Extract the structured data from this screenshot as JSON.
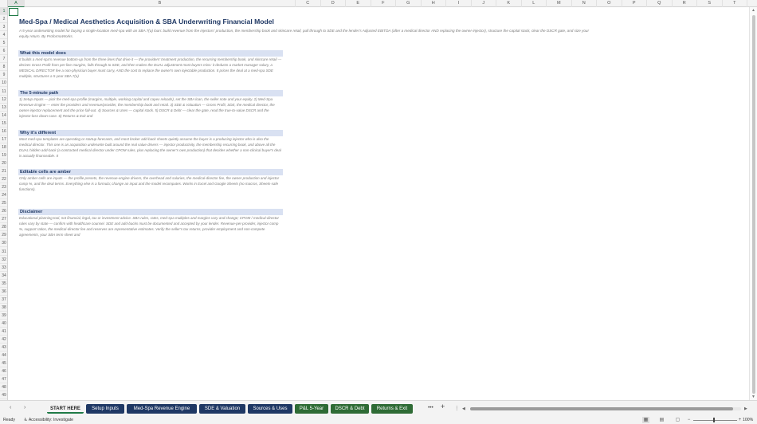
{
  "columns": [
    "A",
    "B",
    "C",
    "D",
    "E",
    "F",
    "G",
    "H",
    "I",
    "J",
    "K",
    "L",
    "M",
    "N",
    "O",
    "P",
    "Q",
    "R",
    "S",
    "T"
  ],
  "active_column": "A",
  "active_row": "1",
  "rows": [
    "1",
    "2",
    "3",
    "4",
    "5",
    "6",
    "7",
    "8",
    "9",
    "10",
    "11",
    "12",
    "13",
    "14",
    "15",
    "16",
    "17",
    "18",
    "19",
    "20",
    "21",
    "22",
    "23",
    "24",
    "25",
    "26",
    "27",
    "28",
    "29",
    "30",
    "31",
    "32",
    "33",
    "34",
    "35",
    "36",
    "37",
    "38",
    "39",
    "40",
    "41",
    "42",
    "43",
    "44",
    "45",
    "46",
    "47",
    "48",
    "49"
  ],
  "sheet": {
    "title": "Med-Spa / Medical Aesthetics Acquisition & SBA Underwriting Financial Model",
    "subtitle": "A 5-year underwriting model for buying a single-location med-spa with an SBA 7(a) loan: build revenue from the injectors' production, the membership book and skincare retail, pull through to SDE and the lender's Adjusted EBITDA (after a medical director AND replacing the owner-injector), structure the capital stack, clear the DSCR gate, and size your equity return. By ProformaWorks.",
    "sections": [
      {
        "heading": "What this model does",
        "body": "It builds a med-spa's revenue bottom-up from the three lines that drive it — the providers' treatment production, the recurring membership book, and skincare retail — derives Gross Profit from per-line margins, falls through to SDE, and then makes the DUAL adjustment most buyers miss: it deducts a market manager salary, a MEDICAL DIRECTOR fee a non-physician buyer must carry, AND the cost to replace the owner's own injectable production. It prices the deal at a med-spa SDE multiple, structures a 5-year SBA 7(a)"
      },
      {
        "heading": "The 5-minute path",
        "body": "1) Setup Inputs — pick the med-spa profile (margins, multiple, working capital and capex reloads), set the SBA loan, the seller note and your equity.  2) Med-Spa Revenue Engine — enter the providers and revenue/provider, the membership book and retail.  3) SDE & Valuation — Gross Profit, SDE, the medical director, the owner-injector replacement and the price fall-out.  4) Sources & Uses — capital stack.  5) DSCR & Debt — clear the gate, read the true-to-value DSCR and the injector-loss down-case.  6) Returns & Exit and"
      },
      {
        "heading": "Why it's different",
        "body": "Most med-spa templates are operating or startup forecasts, and most broker add-back sheets quietly assume the buyer is a producing injector who is also the medical director. This one is an acquisition underwrite built around the real value drivers — injector productivity, the membership recurring book, and above all the DUAL hidden add-back (a contracted medical director under CPOM rules, plus replacing the owner's own production) that decides whether a non-clinical buyer's deal is actually financeable. It"
      },
      {
        "heading": "Editable cells are amber",
        "body": "Only amber cells are inputs — the profile presets, the revenue-engine drivers, the overhead and salaries, the medical-director fee, the owner production and injector comp %, and the deal terms. Everything else is a formula; change an input and the model recomputes. Works in Excel and Google Sheets (no macros, Sheets-safe functions)."
      },
      {
        "heading": "Disclaimer",
        "body": "Educational planning tool, not financial, legal, tax or investment advice. SBA rules, rates, med-spa multiples and margins vary and change; CPOM / medical-director rules vary by state — confirm with healthcare counsel. SDE and add-backs must be documented and accepted by your lender. Revenue-per-provider, injector comp %, support ratios, the medical-director fee and reserves are representative estimates. Verify the seller's tax returns, provider employment and non-compete agreements, your SBA term sheet and"
      }
    ]
  },
  "tabs": [
    {
      "label": "START HERE",
      "style": "start"
    },
    {
      "label": "Setup Inputs",
      "style": "navy"
    },
    {
      "label": "Med-Spa Revenue Engine",
      "style": "navy"
    },
    {
      "label": "SDE & Valuation",
      "style": "navy"
    },
    {
      "label": "Sources & Uses",
      "style": "navy"
    },
    {
      "label": "P&L 5-Year",
      "style": "green"
    },
    {
      "label": "DSCR & Debt",
      "style": "green"
    },
    {
      "label": "Returns & Exit",
      "style": "green"
    }
  ],
  "tabbar": {
    "more": "•••",
    "add": "+",
    "menu": "⋮"
  },
  "status": {
    "ready": "Ready",
    "accessibility": "Accessibility: Investigate",
    "zoom": "100%"
  }
}
